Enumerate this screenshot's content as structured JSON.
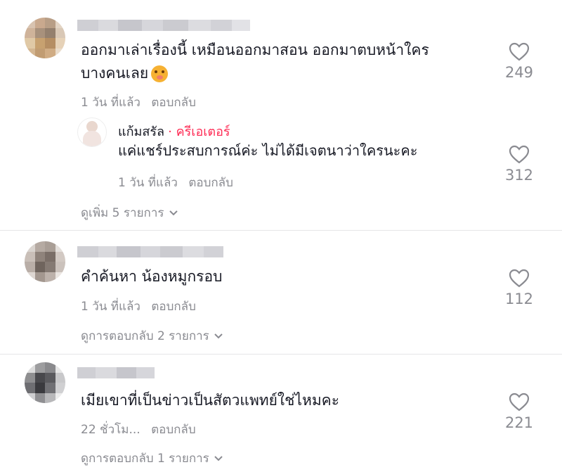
{
  "comments": [
    {
      "text_line1": "ออกมาเล่าเรื่องนี้ เหมือนออกมาสอน ออกมาตบหน้าใคร",
      "text_line2": "บางคนเลย",
      "emoji_icon": "shushing-face-emoji",
      "time": "1 วัน ที่แล้ว",
      "reply_label": "ตอบกลับ",
      "likes": "249",
      "reply": {
        "author": "แก้มสรัล",
        "creator_label": "· ครีเอเตอร์",
        "text": "แค่แชร์ประสบการณ์ค่ะ ไม่ได้มีเจตนาว่าใครนะคะ",
        "time": "1 วัน ที่แล้ว",
        "reply_label": "ตอบกลับ",
        "likes": "312"
      },
      "view_more": "ดูเพิ่ม 5 รายการ"
    },
    {
      "text": "คำค้นหา น้องหมูกรอบ",
      "time": "1 วัน ที่แล้ว",
      "reply_label": "ตอบกลับ",
      "likes": "112",
      "view_more": "ดูการตอบกลับ 2 รายการ"
    },
    {
      "text": "เมียเขาที่เป็นข่าวเป็นสัตวแพทย์ใช่ไหมคะ",
      "time": "22 ชั่วโม...",
      "reply_label": "ตอบกลับ",
      "likes": "221",
      "view_more": "ดูการตอบกลับ 1 รายการ"
    }
  ],
  "colors": {
    "accent_creator": "#fe2c55",
    "meta_gray": "#8a8b91",
    "text": "#161823"
  }
}
